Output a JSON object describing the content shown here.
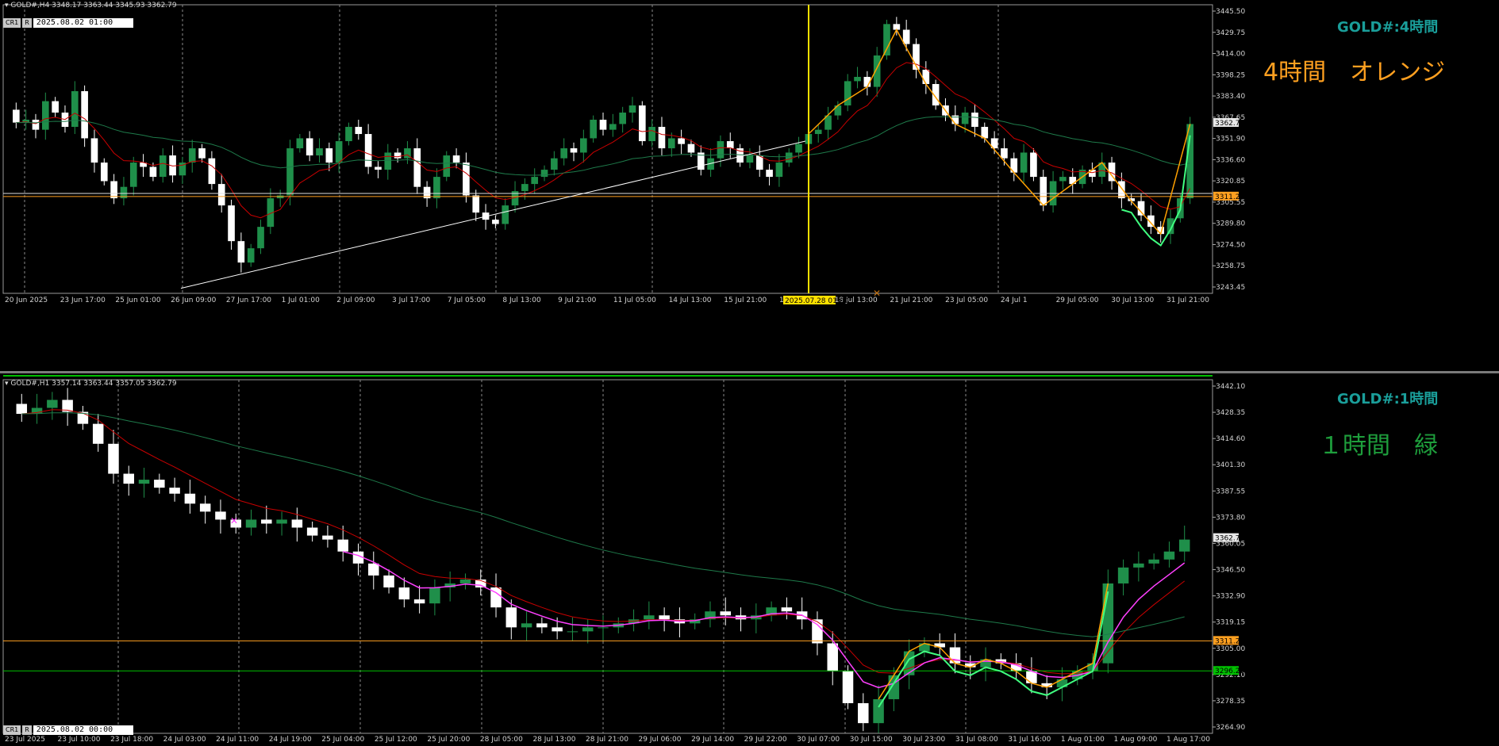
{
  "colors": {
    "background": "#000000",
    "grid": "#8a8a8a",
    "bull_candle": "#1f8f4a",
    "bear_candle": "#ffffff",
    "ma_red": "#c80000",
    "ma_green": "#1e7a4a",
    "hline_orange": "#ffa020",
    "hline_green": "#00c000",
    "vline_yellow": "#ffe000",
    "zigzag_orange": "#ffa000",
    "zigzag_green": "#40ff80",
    "magenta": "#ff40ff",
    "trendline": "#ffffff",
    "title_teal": "#1a9e9a",
    "label_orange": "#ffa020",
    "label_green": "#1e9e3c"
  },
  "icons": [
    "dropdown-triangle-icon",
    "arrow-marker-icon"
  ],
  "top_pane": {
    "header": "GOLD#,H4  3348.17 3363.44 3345.93 3362.79",
    "buttons": [
      "CR1",
      "R"
    ],
    "date_field": "2025.08.02 01:00",
    "title": "GOLD#:4時間",
    "big_label": "4時間　オレンジ",
    "cursor_time": "2025.07.28 01:00",
    "price_tag": "3362.79",
    "hline_tag": "3311.25"
  },
  "bottom_pane": {
    "header": "GOLD#,H1  3357.14 3363.44 3357.05 3362.79",
    "buttons": [
      "CR1",
      "R"
    ],
    "date_field": "2025.08.02 00:00",
    "title": "GOLD#:1時間",
    "big_label": "１時間　緑",
    "price_tag": "3362.79",
    "hline_tag": "3311.25",
    "green_tag": "3296.20"
  },
  "chart_data": [
    {
      "type": "candlestick",
      "symbol": "GOLD#",
      "timeframe": "H4",
      "ylim": [
        3243.45,
        3445.5
      ],
      "yticks": [
        "3445.50",
        "3429.75",
        "3414.00",
        "3398.25",
        "3383.40",
        "3367.65",
        "3351.90",
        "3336.60",
        "3320.85",
        "3305.55",
        "3289.80",
        "3274.50",
        "3258.75",
        "3243.45"
      ],
      "xticks": [
        "20 Jun 2025",
        "23 Jun 17:00",
        "25 Jun 01:00",
        "26 Jun 09:00",
        "27 Jun 17:00",
        "1 Jul 01:00",
        "2 Jul 09:00",
        "3 Jul 17:00",
        "7 Jul 05:00",
        "8 Jul 13:00",
        "9 Jul 21:00",
        "11 Jul 05:00",
        "14 Jul 13:00",
        "15 Jul 21:00",
        "17 Jul 05:00",
        "18 Jul 13:00",
        "21 Jul 21:00",
        "23 Jul 05:00",
        "24 Jul 1",
        "29 Jul 05:00",
        "30 Jul 13:00",
        "31 Jul 21:00"
      ],
      "price_path": [
        3372,
        3363,
        3365,
        3358,
        3378,
        3370,
        3360,
        3385,
        3352,
        3335,
        3322,
        3310,
        3318,
        3335,
        3332,
        3325,
        3340,
        3326,
        3335,
        3345,
        3338,
        3320,
        3305,
        3280,
        3265,
        3275,
        3290,
        3310,
        3312,
        3345,
        3352,
        3340,
        3345,
        3335,
        3350,
        3360,
        3355,
        3332,
        3330,
        3342,
        3338,
        3345,
        3318,
        3310,
        3325,
        3340,
        3335,
        3312,
        3300,
        3295,
        3292,
        3305,
        3315,
        3320,
        3325,
        3330,
        3338,
        3345,
        3342,
        3352,
        3365,
        3358,
        3362,
        3370,
        3375,
        3350,
        3360,
        3345,
        3352,
        3348,
        3342,
        3330,
        3338,
        3350,
        3345,
        3335,
        3340,
        3330,
        3325,
        3335,
        3342,
        3348,
        3355,
        3358,
        3368,
        3375,
        3392,
        3395,
        3388,
        3410,
        3432,
        3428,
        3418,
        3400,
        3390,
        3375,
        3368,
        3362,
        3370,
        3360,
        3352,
        3345,
        3338,
        3328,
        3342,
        3325,
        3305,
        3322,
        3325,
        3320,
        3330,
        3325,
        3335,
        3322,
        3310,
        3308,
        3298,
        3290,
        3285,
        3296,
        3310,
        3362
      ],
      "hlines": [
        3311.25,
        3313.0
      ],
      "current_price": 3362.79
    },
    {
      "type": "candlestick",
      "symbol": "GOLD#",
      "timeframe": "H1",
      "ylim": [
        3264.9,
        3442.1
      ],
      "yticks": [
        "3442.10",
        "3428.35",
        "3414.60",
        "3401.30",
        "3387.55",
        "3373.80",
        "3360.05",
        "3346.50",
        "3332.90",
        "3319.15",
        "3305.00",
        "3292.10",
        "3278.35",
        "3264.90"
      ],
      "xticks": [
        "23 Jul 2025",
        "23 Jul 10:00",
        "23 Jul 18:00",
        "24 Jul 03:00",
        "24 Jul 11:00",
        "24 Jul 19:00",
        "25 Jul 04:00",
        "25 Jul 12:00",
        "25 Jul 20:00",
        "28 Jul 05:00",
        "28 Jul 13:00",
        "28 Jul 21:00",
        "29 Jul 06:00",
        "29 Jul 14:00",
        "29 Jul 22:00",
        "30 Jul 07:00",
        "30 Jul 15:00",
        "30 Jul 23:00",
        "31 Jul 08:00",
        "31 Jul 16:00",
        "1 Aug 01:00",
        "1 Aug 09:00",
        "1 Aug 17:00"
      ],
      "price_path": [
        3430,
        3425,
        3428,
        3432,
        3426,
        3420,
        3410,
        3395,
        3390,
        3392,
        3388,
        3385,
        3380,
        3376,
        3372,
        3368,
        3372,
        3370,
        3372,
        3368,
        3364,
        3362,
        3356,
        3350,
        3344,
        3338,
        3332,
        3330,
        3338,
        3340,
        3342,
        3338,
        3328,
        3318,
        3320,
        3318,
        3316,
        3316,
        3318,
        3318,
        3320,
        3322,
        3324,
        3322,
        3320,
        3322,
        3326,
        3324,
        3322,
        3324,
        3328,
        3326,
        3322,
        3310,
        3296,
        3280,
        3270,
        3282,
        3294,
        3306,
        3310,
        3308,
        3300,
        3298,
        3302,
        3300,
        3296,
        3290,
        3288,
        3292,
        3296,
        3300,
        3340,
        3348,
        3350,
        3352,
        3356,
        3362
      ],
      "hlines": [
        3311.25,
        3296.2
      ],
      "current_price": 3362.79
    }
  ]
}
